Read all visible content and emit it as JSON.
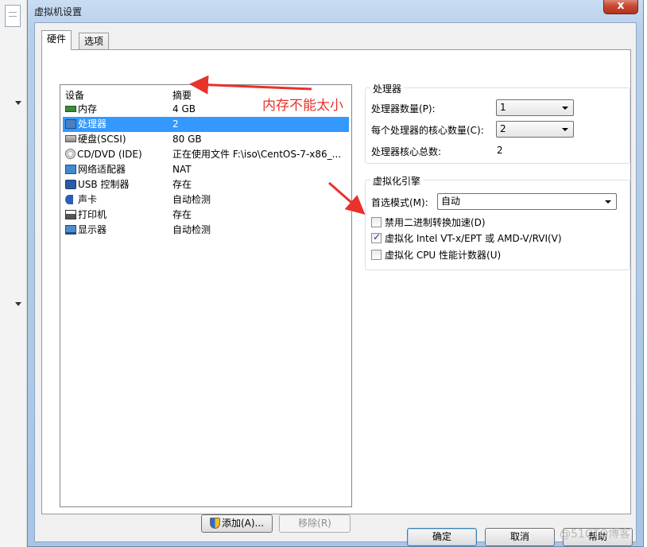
{
  "window": {
    "title": "虚拟机设置",
    "close_label": "x"
  },
  "tabs": [
    {
      "label": "硬件"
    },
    {
      "label": "选项"
    }
  ],
  "device_list": {
    "headers": {
      "device": "设备",
      "summary": "摘要"
    },
    "rows": [
      {
        "device": "内存",
        "summary": "4 GB",
        "icon": "memory-icon"
      },
      {
        "device": "处理器",
        "summary": "2",
        "icon": "processor-icon"
      },
      {
        "device": "硬盘(SCSI)",
        "summary": "80 GB",
        "icon": "hard-disk-icon"
      },
      {
        "device": "CD/DVD (IDE)",
        "summary": "正在使用文件 F:\\iso\\CentOS-7-x86_...",
        "icon": "cd-dvd-icon"
      },
      {
        "device": "网络适配器",
        "summary": "NAT",
        "icon": "network-adapter-icon"
      },
      {
        "device": "USB 控制器",
        "summary": "存在",
        "icon": "usb-icon"
      },
      {
        "device": "声卡",
        "summary": "自动检测",
        "icon": "sound-card-icon"
      },
      {
        "device": "打印机",
        "summary": "存在",
        "icon": "printer-icon"
      },
      {
        "device": "显示器",
        "summary": "自动检测",
        "icon": "display-icon"
      }
    ],
    "selected_index": 1
  },
  "buttons": {
    "add": "添加(A)...",
    "remove": "移除(R)",
    "ok": "确定",
    "cancel": "取消",
    "help": "帮助"
  },
  "processor": {
    "group_title": "处理器",
    "count_label": "处理器数量(P):",
    "count_value": "1",
    "cores_label": "每个处理器的核心数量(C):",
    "cores_value": "2",
    "total_label": "处理器核心总数:",
    "total_value": "2"
  },
  "virtualization": {
    "group_title": "虚拟化引擎",
    "mode_label": "首选模式(M):",
    "mode_value": "自动",
    "options": [
      {
        "label": "禁用二进制转换加速(D)",
        "checked": false
      },
      {
        "label": "虚拟化 Intel VT-x/EPT 或 AMD-V/RVI(V)",
        "checked": true
      },
      {
        "label": "虚拟化 CPU 性能计数器(U)",
        "checked": false
      }
    ]
  },
  "annotation": {
    "text": "内存不能太小",
    "color": "#e8322a"
  },
  "watermark": "@51CTO博客"
}
